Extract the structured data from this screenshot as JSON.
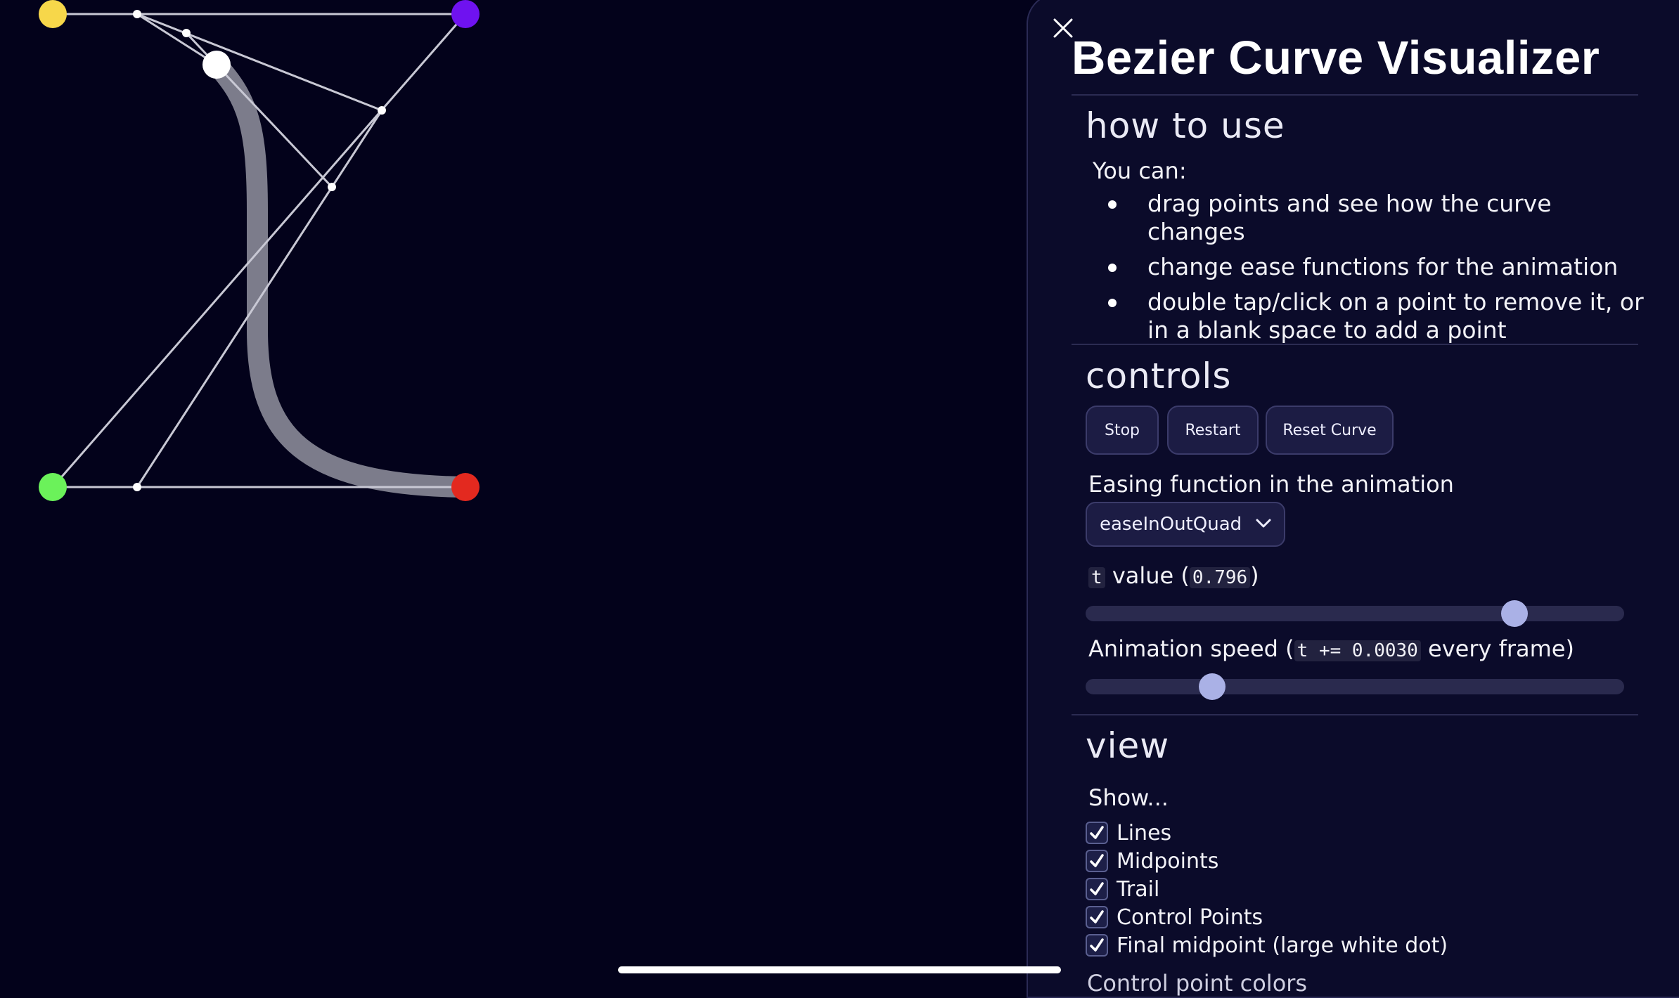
{
  "panel": {
    "title": "Bezier Curve Visualizer",
    "close_icon": "close-icon",
    "how_to_use": {
      "heading": "how to use",
      "intro": "You can:",
      "items": [
        "drag points and see how the curve changes",
        "change ease functions for the animation",
        "double tap/click on a point to remove it, or in a blank space to add a point"
      ]
    },
    "controls": {
      "heading": "controls",
      "buttons": {
        "stop": "Stop",
        "restart": "Restart",
        "reset": "Reset Curve"
      },
      "easing_label": "Easing function in the animation",
      "easing_selected": "easeInOutQuad",
      "t_code": "t",
      "t_label": "value (",
      "t_value": "0.796",
      "t_close": ")",
      "t_slider_fraction": 0.796,
      "speed_label": "Animation speed (",
      "speed_code": "t += 0.0030",
      "speed_suffix": "every frame)",
      "speed_slider_fraction": 0.235
    },
    "view": {
      "heading": "view",
      "show_label": "Show...",
      "options": [
        {
          "label": "Lines",
          "checked": true
        },
        {
          "label": "Midpoints",
          "checked": true
        },
        {
          "label": "Trail",
          "checked": true
        },
        {
          "label": "Control Points",
          "checked": true
        },
        {
          "label": "Final midpoint (large white dot)",
          "checked": true
        }
      ],
      "next_section_cut": "Control point colors"
    }
  },
  "canvas": {
    "colors": {
      "background": "#03021b",
      "point_yellow": "#f7d74a",
      "point_purple": "#6f12f0",
      "point_green": "#6bf25a",
      "point_red": "#e3291f",
      "lines": "#c8c8d4",
      "trail": "#8a8a98",
      "final_point": "#ffffff"
    }
  }
}
